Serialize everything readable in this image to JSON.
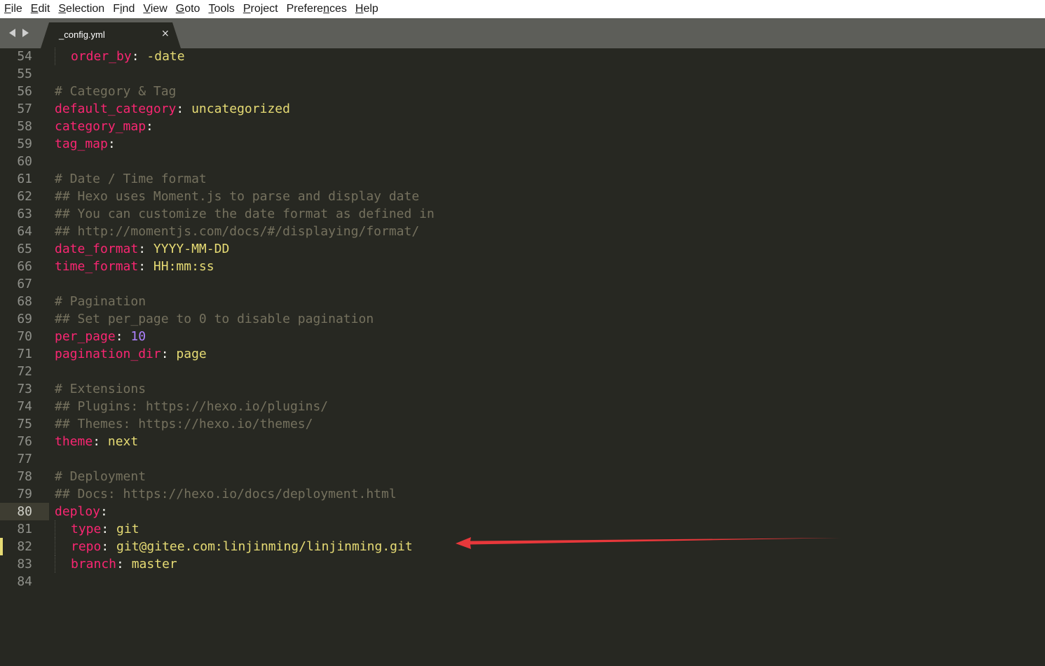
{
  "menu": {
    "items": [
      {
        "pre": "",
        "u": "F",
        "post": "ile"
      },
      {
        "pre": "",
        "u": "E",
        "post": "dit"
      },
      {
        "pre": "",
        "u": "S",
        "post": "election"
      },
      {
        "pre": "F",
        "u": "i",
        "post": "nd"
      },
      {
        "pre": "",
        "u": "V",
        "post": "iew"
      },
      {
        "pre": "",
        "u": "G",
        "post": "oto"
      },
      {
        "pre": "",
        "u": "T",
        "post": "ools"
      },
      {
        "pre": "",
        "u": "P",
        "post": "roject"
      },
      {
        "pre": "Prefere",
        "u": "n",
        "post": "ces"
      },
      {
        "pre": "",
        "u": "H",
        "post": "elp"
      }
    ]
  },
  "tab": {
    "title": "_config.yml",
    "close_glyph": "×"
  },
  "editor": {
    "current_line": "80",
    "modified_line": "82",
    "lines": [
      {
        "num": "54",
        "indent": true,
        "key": "order_by",
        "sep": ": ",
        "val": "-date"
      },
      {
        "num": "55"
      },
      {
        "num": "56",
        "comment": "# Category & Tag"
      },
      {
        "num": "57",
        "key": "default_category",
        "sep": ": ",
        "val": "uncategorized"
      },
      {
        "num": "58",
        "key": "category_map",
        "sep": ":"
      },
      {
        "num": "59",
        "key": "tag_map",
        "sep": ":"
      },
      {
        "num": "60"
      },
      {
        "num": "61",
        "comment": "# Date / Time format"
      },
      {
        "num": "62",
        "comment": "## Hexo uses Moment.js to parse and display date"
      },
      {
        "num": "63",
        "comment": "## You can customize the date format as defined in"
      },
      {
        "num": "64",
        "comment": "## http://momentjs.com/docs/#/displaying/format/"
      },
      {
        "num": "65",
        "key": "date_format",
        "sep": ": ",
        "val": "YYYY-MM-DD"
      },
      {
        "num": "66",
        "key": "time_format",
        "sep": ": ",
        "val": "HH:mm:ss"
      },
      {
        "num": "67"
      },
      {
        "num": "68",
        "comment": "# Pagination"
      },
      {
        "num": "69",
        "comment": "## Set per_page to 0 to disable pagination"
      },
      {
        "num": "70",
        "key": "per_page",
        "sep": ": ",
        "num_val": "10"
      },
      {
        "num": "71",
        "key": "pagination_dir",
        "sep": ": ",
        "val": "page"
      },
      {
        "num": "72"
      },
      {
        "num": "73",
        "comment": "# Extensions"
      },
      {
        "num": "74",
        "comment": "## Plugins: https://hexo.io/plugins/"
      },
      {
        "num": "75",
        "comment": "## Themes: https://hexo.io/themes/"
      },
      {
        "num": "76",
        "key": "theme",
        "sep": ": ",
        "val": "next"
      },
      {
        "num": "77"
      },
      {
        "num": "78",
        "comment": "# Deployment"
      },
      {
        "num": "79",
        "comment": "## Docs: https://hexo.io/docs/deployment.html"
      },
      {
        "num": "80",
        "key": "deploy",
        "sep": ":"
      },
      {
        "num": "81",
        "indent": true,
        "key": "type",
        "sep": ": ",
        "val": "git"
      },
      {
        "num": "82",
        "indent": true,
        "key": "repo",
        "sep": ": ",
        "val": "git@gitee.com:linjinming/linjinming.git"
      },
      {
        "num": "83",
        "indent": true,
        "key": "branch",
        "sep": ": ",
        "val": "master"
      },
      {
        "num": "84"
      }
    ]
  },
  "colors": {
    "background": "#272822",
    "key": "#f92672",
    "string": "#e6db74",
    "number": "#ae81ff",
    "comment": "#75715e",
    "annotation_arrow": "#e8383b"
  },
  "annotation": {
    "icon": "red-arrow-icon"
  }
}
